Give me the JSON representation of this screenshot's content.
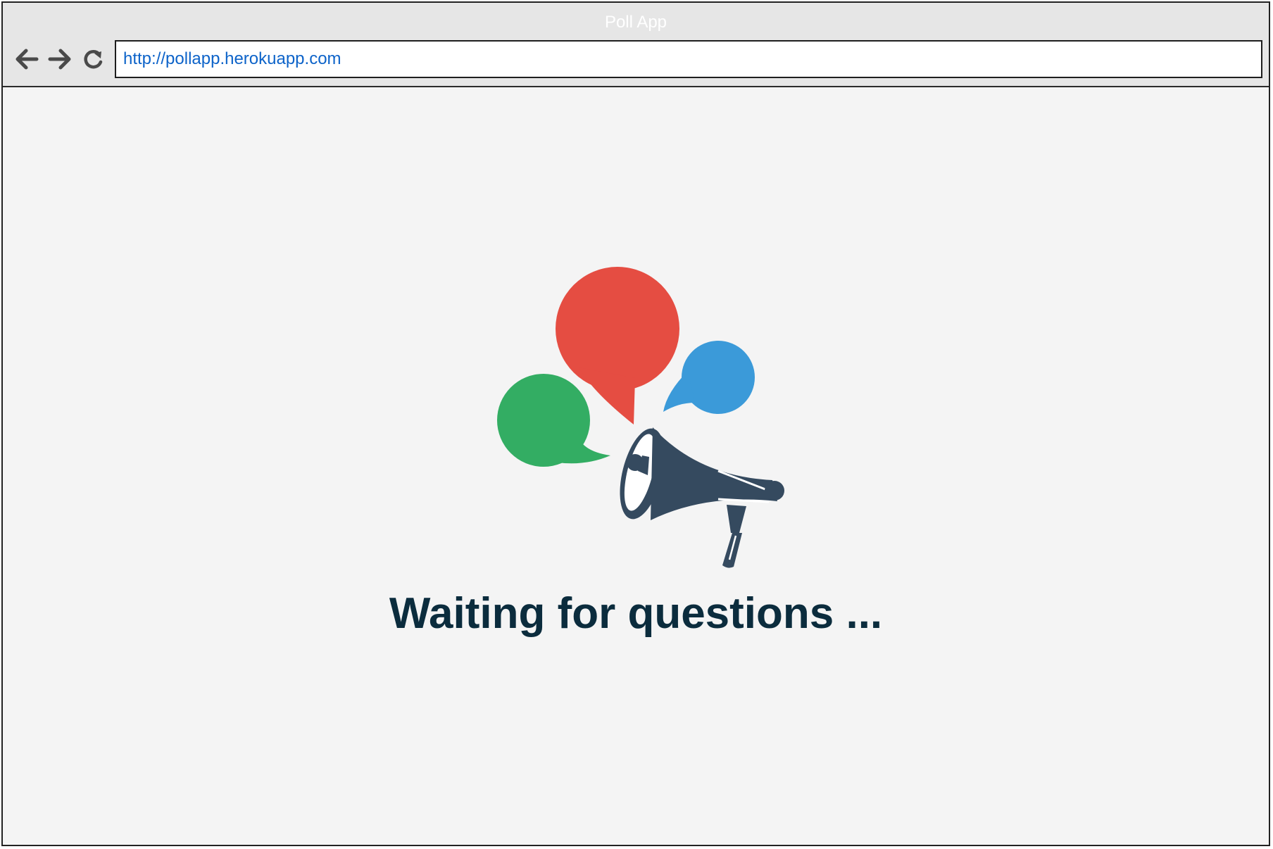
{
  "window": {
    "title": "Poll App"
  },
  "toolbar": {
    "back_icon": "arrow-left-icon",
    "forward_icon": "arrow-right-icon",
    "reload_icon": "reload-icon"
  },
  "address_bar": {
    "url": "http://pollapp.herokuapp.com"
  },
  "main": {
    "illustration": {
      "icon": "megaphone-with-speech-bubbles-icon",
      "colors": {
        "red_bubble": "#e54d42",
        "green_bubble": "#33ad63",
        "blue_bubble": "#3b9ad9",
        "megaphone": "#354a5f"
      }
    },
    "status_text": "Waiting for questions ..."
  },
  "colors": {
    "chrome_bg": "#e6e6e6",
    "content_bg": "#f4f4f4",
    "url_text": "#0d63c9",
    "status_text": "#0b2c3d"
  }
}
